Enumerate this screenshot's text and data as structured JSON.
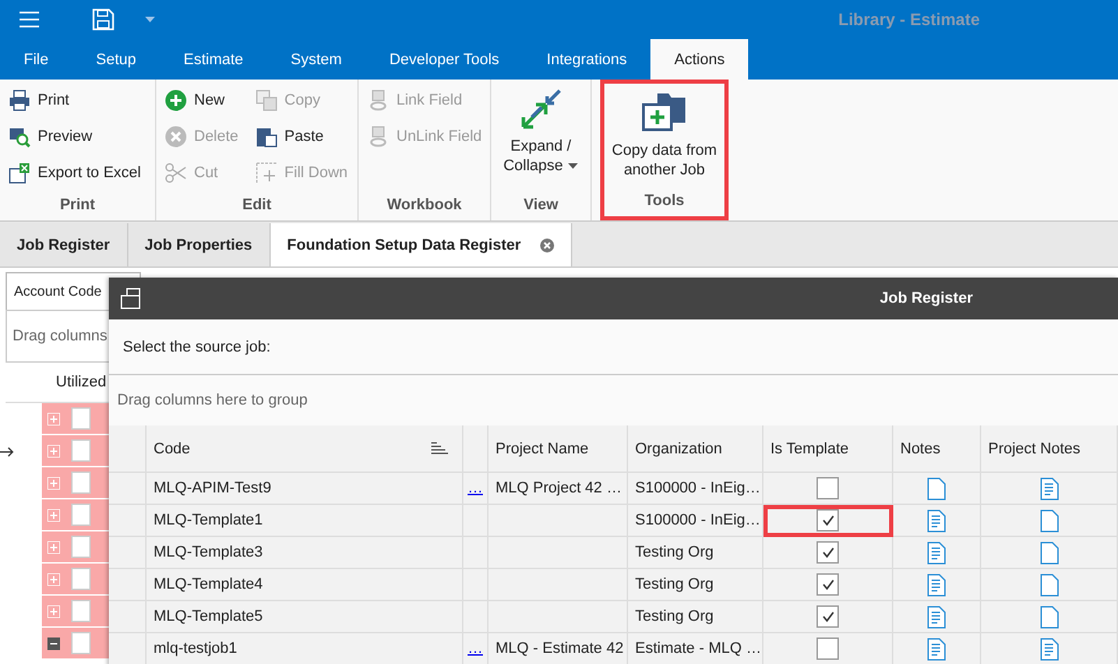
{
  "window": {
    "title": "Library - Estimate"
  },
  "menu_tabs": [
    {
      "label": "File",
      "selected": false
    },
    {
      "label": "Setup",
      "selected": false
    },
    {
      "label": "Estimate",
      "selected": false
    },
    {
      "label": "System",
      "selected": false
    },
    {
      "label": "Developer Tools",
      "selected": false
    },
    {
      "label": "Integrations",
      "selected": false
    },
    {
      "label": "Actions",
      "selected": true
    }
  ],
  "ribbon_groups": [
    {
      "label": "Print",
      "highlighted": false,
      "items": [
        {
          "label": "Print",
          "disabled": false
        },
        {
          "label": "Preview",
          "disabled": false
        },
        {
          "label": "Export to Excel",
          "disabled": false
        }
      ]
    },
    {
      "label": "Edit",
      "highlighted": false,
      "items": [
        {
          "label": "New",
          "disabled": false
        },
        {
          "label": "Delete",
          "disabled": true
        },
        {
          "label": "Cut",
          "disabled": true
        },
        {
          "label": "Copy",
          "disabled": true
        },
        {
          "label": "Paste",
          "disabled": false
        },
        {
          "label": "Fill Down",
          "disabled": true
        }
      ]
    },
    {
      "label": "Workbook",
      "highlighted": false,
      "items": [
        {
          "label": "Link Field",
          "disabled": true
        },
        {
          "label": "UnLink Field",
          "disabled": true
        }
      ]
    },
    {
      "label": "View",
      "highlighted": false,
      "large": {
        "label": "Expand / Collapse",
        "dropdown": true
      }
    },
    {
      "label": "Tools",
      "highlighted": true,
      "large": {
        "label": "Copy data from another Job",
        "dropdown": false
      }
    }
  ],
  "doc_tabs": [
    {
      "label": "Job Register",
      "selected": false
    },
    {
      "label": "Job Properties",
      "selected": false
    },
    {
      "label": "Foundation Setup Data Register",
      "selected": true
    }
  ],
  "background": {
    "sub_tab": "Account Code",
    "group_hint": "Drag columns",
    "column": "Utilized",
    "rows": [
      {
        "current": false,
        "expanded": false,
        "checked": false
      },
      {
        "current": true,
        "expanded": false,
        "checked": false
      },
      {
        "current": false,
        "expanded": false,
        "checked": false
      },
      {
        "current": false,
        "expanded": false,
        "checked": false
      },
      {
        "current": false,
        "expanded": false,
        "checked": false
      },
      {
        "current": false,
        "expanded": false,
        "checked": false
      },
      {
        "current": false,
        "expanded": false,
        "checked": false
      },
      {
        "current": false,
        "expanded": true,
        "checked": false
      }
    ]
  },
  "dialog": {
    "title": "Job Register",
    "prompt": "Select the source job:",
    "group_hint": "Drag columns here to group",
    "columns": {
      "code": "Code",
      "project_name": "Project Name",
      "organization": "Organization",
      "is_template": "Is Template",
      "notes": "Notes",
      "project_notes": "Project Notes"
    },
    "rows": [
      {
        "code": "MLQ-APIM-Test9",
        "link": "…",
        "project_name": "MLQ Project 42 …",
        "organization": "S100000 - InEig…",
        "is_template": false,
        "template_highlighted": false,
        "notes_filled": false,
        "project_notes_filled": true
      },
      {
        "code": "MLQ-Template1",
        "organization": "S100000 - InEig…",
        "is_template": true,
        "template_highlighted": true,
        "notes_filled": true,
        "project_notes_filled": false
      },
      {
        "code": "MLQ-Template3",
        "organization": "Testing Org",
        "is_template": true,
        "template_highlighted": false,
        "notes_filled": true,
        "project_notes_filled": false
      },
      {
        "code": "MLQ-Template4",
        "organization": "Testing Org",
        "is_template": true,
        "template_highlighted": false,
        "notes_filled": true,
        "project_notes_filled": false
      },
      {
        "code": "MLQ-Template5",
        "organization": "Testing Org",
        "is_template": true,
        "template_highlighted": false,
        "notes_filled": true,
        "project_notes_filled": false
      },
      {
        "code": "mlq-testjob1",
        "link": "…",
        "project_name": "MLQ - Estimate 42",
        "organization": "Estimate - MLQ …",
        "is_template": false,
        "template_highlighted": false,
        "notes_filled": true,
        "project_notes_filled": true
      }
    ]
  }
}
